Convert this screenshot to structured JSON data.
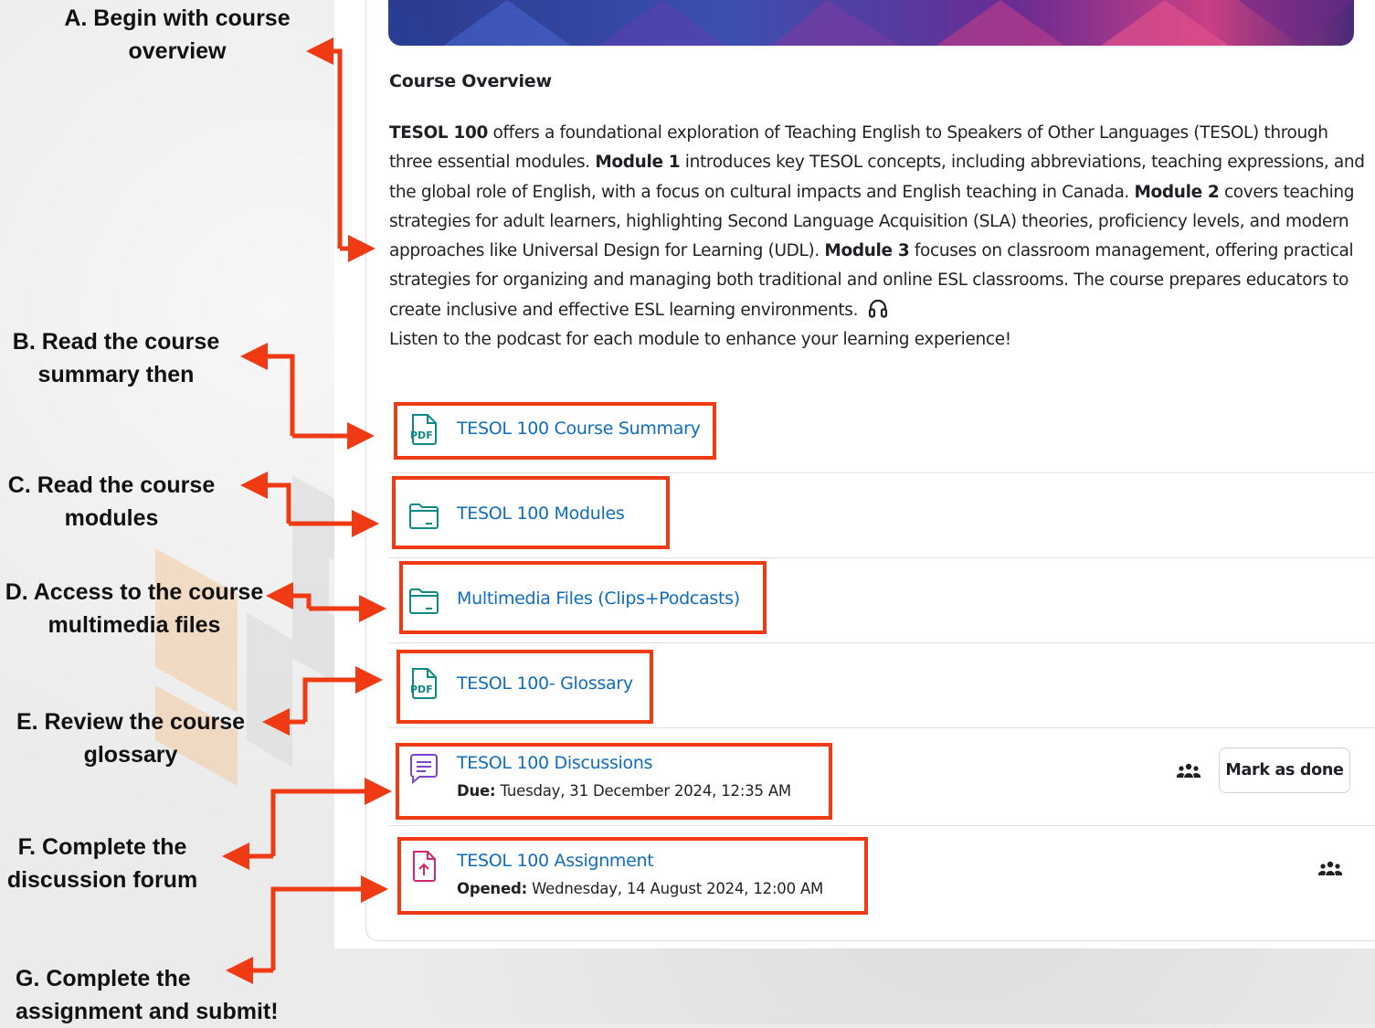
{
  "overview": {
    "heading": "Course Overview",
    "paragraph": [
      {
        "text": "TESOL 100",
        "bold": true
      },
      {
        "text": " offers a foundational exploration of Teaching English to Speakers of Other Languages (TESOL) through three essential modules. ",
        "bold": false
      },
      {
        "text": "Module 1",
        "bold": true
      },
      {
        "text": " introduces key TESOL concepts, including abbreviations, teaching expressions, and the global role of English, with a focus on cultural impacts and English teaching in Canada. ",
        "bold": false
      },
      {
        "text": "Module 2",
        "bold": true
      },
      {
        "text": " covers teaching strategies for adult learners, highlighting Second Language Acquisition (SLA) theories, proficiency levels, and modern approaches like Universal Design for Learning (UDL). ",
        "bold": false
      },
      {
        "text": "Module 3",
        "bold": true
      },
      {
        "text": " focuses on classroom management, offering practical strategies for organizing and managing both traditional and online ESL classrooms. The course prepares educators to create inclusive and effective ESL learning environments.",
        "bold": false
      }
    ],
    "podcast_note": "Listen to the podcast for each module to enhance your learning experience!",
    "headphones_icon": "headphones-icon"
  },
  "activities": [
    {
      "id": "summary",
      "title": "TESOL 100 Course Summary",
      "icon": "pdf-icon"
    },
    {
      "id": "modules",
      "title": "TESOL 100 Modules",
      "icon": "folder-icon"
    },
    {
      "id": "multimedia",
      "title": "Multimedia Files (Clips+Podcasts)",
      "icon": "folder-icon"
    },
    {
      "id": "glossary",
      "title": "TESOL 100- Glossary",
      "icon": "pdf-icon"
    },
    {
      "id": "discussions",
      "title": "TESOL 100 Discussions",
      "icon": "forum-icon",
      "date_label": "Due:",
      "date_value": "Tuesday, 31 December 2024, 12:35 AM"
    },
    {
      "id": "assignment",
      "title": "TESOL 100 Assignment",
      "icon": "assignment-upload-icon",
      "date_label": "Opened:",
      "date_value": "Wednesday, 14 August 2024, 12:00 AM"
    }
  ],
  "mark_done_label": "Mark as done",
  "steps": [
    {
      "id": "A",
      "lines": [
        "A. Begin with course",
        "overview"
      ]
    },
    {
      "id": "B",
      "lines": [
        "B. Read the course",
        "summary then"
      ]
    },
    {
      "id": "C",
      "lines": [
        "C. Read the course",
        "modules"
      ]
    },
    {
      "id": "D",
      "lines": [
        "D. Access to the course",
        "multimedia files"
      ]
    },
    {
      "id": "E",
      "lines": [
        "E. Review the course",
        "glossary"
      ]
    },
    {
      "id": "F",
      "lines": [
        "F. Complete the",
        "discussion forum"
      ]
    },
    {
      "id": "G",
      "lines": [
        "G. Complete the",
        "assignment and submit!"
      ]
    }
  ],
  "colors": {
    "annotation_red": "#ef3a14",
    "link_blue": "#0f6cbf",
    "resource_teal": "#0d8a84",
    "forum_purple": "#7b42d6",
    "assignment_pink": "#d6246e"
  }
}
